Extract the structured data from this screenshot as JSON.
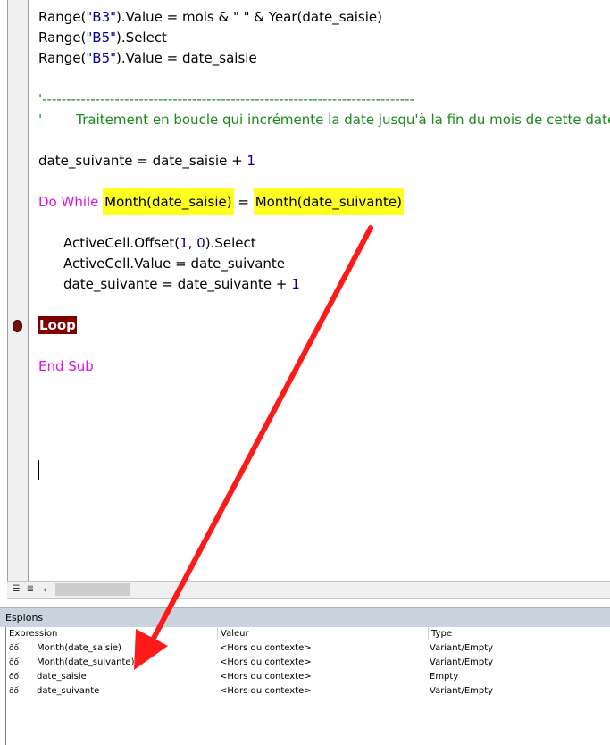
{
  "code": {
    "line1_a": "Range(",
    "line1_str": "\"B3\"",
    "line1_b": ").Value = mois & \" \" & Year(date_saisie)",
    "line2_a": "Range(",
    "line2_str": "\"B5\"",
    "line2_b": ").Select",
    "line3_a": "Range(",
    "line3_str": "\"B5\"",
    "line3_b": ").Value = date_saisie",
    "comment1": "'-----------------------------------------------------------------------------",
    "comment2": "'        Traitement en boucle qui incrémente la date jusqu'à la fin du mois de cette date",
    "assign1_a": "date_suivante = date_saisie + ",
    "assign1_num": "1",
    "dowhile_kw": "Do While ",
    "dowhile_left": "Month(date_saisie)",
    "dowhile_eq": " = ",
    "dowhile_right": "Month(date_suivante)",
    "offset_a": "ActiveCell.Offset(",
    "offset_n1": "1",
    "offset_sep": ", ",
    "offset_n2": "0",
    "offset_b": ").Select",
    "value_line": "ActiveCell.Value = date_suivante",
    "inc_a": "date_suivante = date_suivante + ",
    "inc_num": "1",
    "loop": "Loop",
    "endsub": "End Sub"
  },
  "watch": {
    "title": "Espions",
    "headers": [
      "Expression",
      "Valeur",
      "Type"
    ],
    "rows": [
      {
        "expression": "Month(date_saisie)",
        "valeur": "<Hors du contexte>",
        "type": "Variant/Empty"
      },
      {
        "expression": "Month(date_suivante)",
        "valeur": "<Hors du contexte>",
        "type": "Variant/Empty"
      },
      {
        "expression": "date_saisie",
        "valeur": "<Hors du contexte>",
        "type": "Empty"
      },
      {
        "expression": "date_suivante",
        "valeur": "<Hors du contexte>",
        "type": "Variant/Empty"
      }
    ]
  },
  "colors": {
    "keyword": "#e010e0",
    "comment": "#1a8a1a",
    "highlight": "#ffff22",
    "breakpoint": "#800000",
    "annotation_arrow": "#ff1a1a"
  }
}
